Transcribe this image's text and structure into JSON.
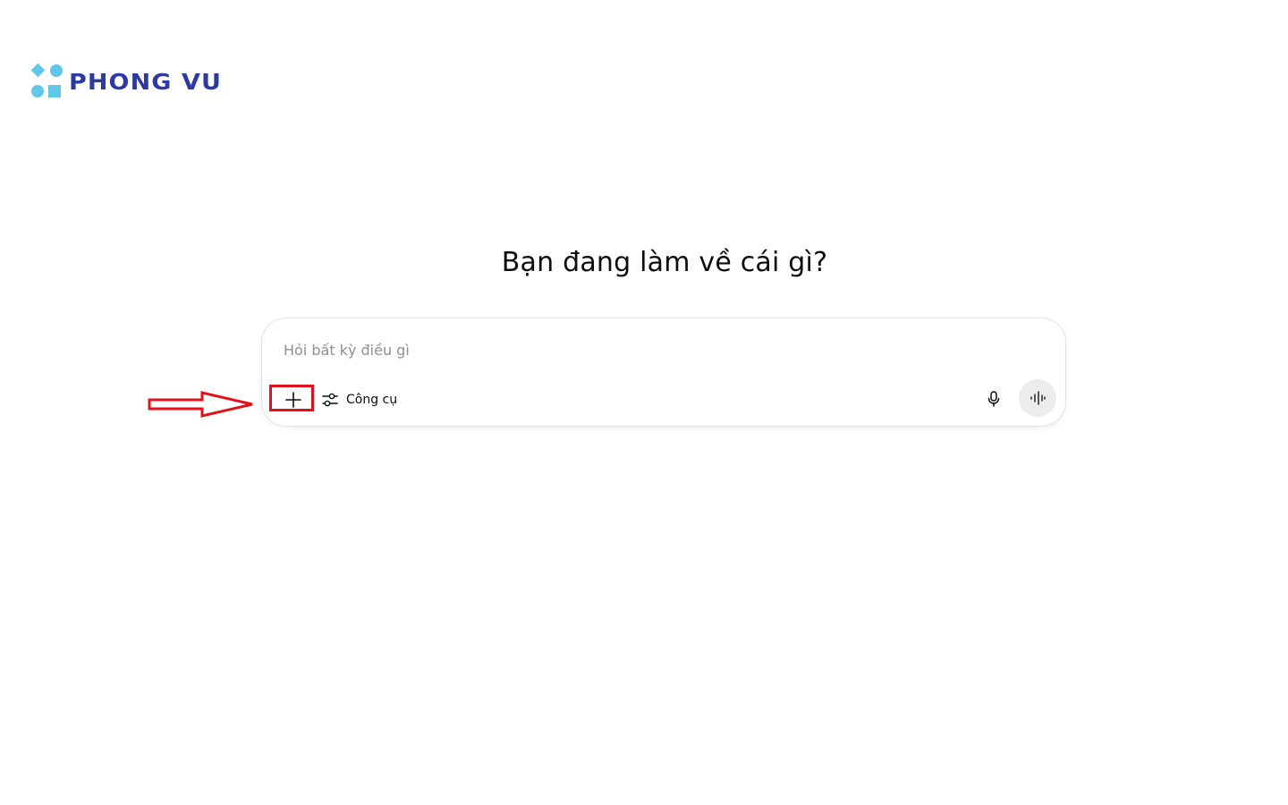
{
  "brand": {
    "name": "PHONG VU",
    "mark_icon": "phongvu-logo-icon",
    "colors": {
      "wordmark": "#2d3ba0",
      "mark": "#5fc8e8"
    }
  },
  "main": {
    "heading": "Bạn đang làm về cái gì?"
  },
  "composer": {
    "placeholder": "Hỏi bất kỳ điều gì",
    "value": "",
    "add_icon": "plus-icon",
    "tools_icon": "sliders-icon",
    "tools_label": "Công cụ",
    "mic_icon": "microphone-icon",
    "voice_icon": "voice-waveform-icon"
  },
  "annotation": {
    "arrow_icon": "right-arrow-icon",
    "highlight_color": "#e2101a"
  }
}
